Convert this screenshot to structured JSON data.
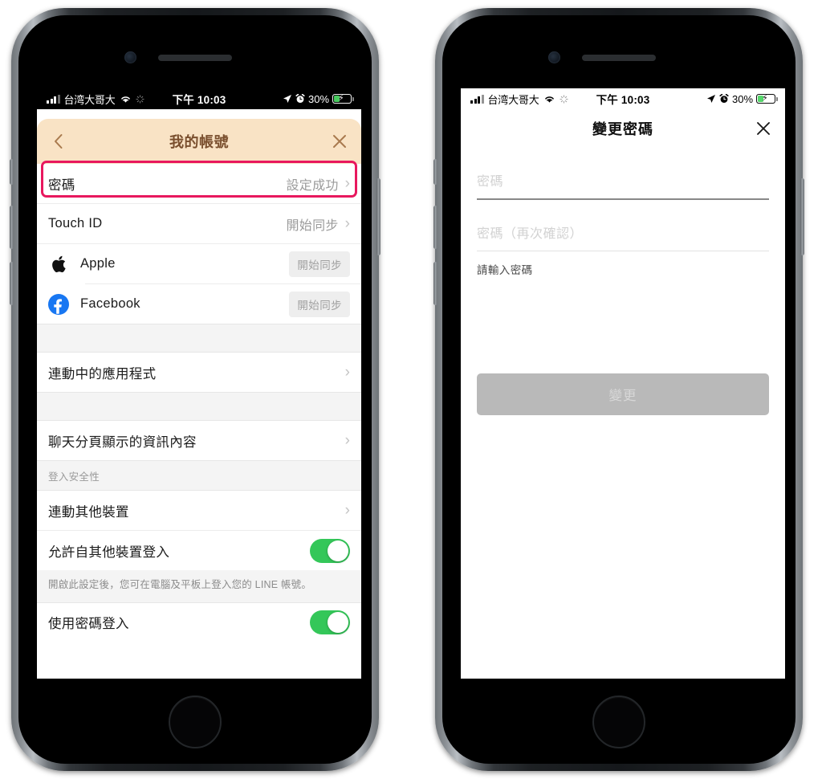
{
  "status_bar": {
    "carrier": "台湾大哥大",
    "time": "下午 10:03",
    "battery_percent": "30%",
    "icons": {
      "signal": "signal-bars-icon",
      "wifi": "wifi-icon",
      "sync": "sync-spinner-icon",
      "location": "location-arrow-icon",
      "alarm": "alarm-clock-icon",
      "battery": "battery-charging-icon"
    }
  },
  "colors": {
    "header_beige": "#f9e3c5",
    "header_beige_back": "#e7cfa9",
    "header_text": "#7a4f2e",
    "highlight_pink": "#e8185e",
    "toggle_green": "#34c759",
    "facebook_blue": "#1877f2",
    "disabled_button": "#b9b9b9"
  },
  "left_phone": {
    "header": {
      "title": "我的帳號",
      "back_icon": "chevron-left-icon",
      "close_icon": "close-x-icon"
    },
    "rows": [
      {
        "label": "密碼",
        "value": "設定成功",
        "arrow": "›",
        "highlighted": true
      },
      {
        "label": "Touch ID",
        "value": "開始同步",
        "arrow": "›",
        "highlighted": false
      }
    ],
    "brand_rows": [
      {
        "icon": "apple-logo-icon",
        "label": "Apple",
        "button": "開始同步"
      },
      {
        "icon": "facebook-logo-icon",
        "label": "Facebook",
        "button": "開始同步"
      }
    ],
    "nav_rows": [
      {
        "label": "連動中的應用程式",
        "arrow": "›"
      },
      {
        "label": "聊天分頁顯示的資訊內容",
        "arrow": "›"
      }
    ],
    "security_section": {
      "header": "登入安全性",
      "link_row": {
        "label": "連動其他裝置",
        "arrow": "›"
      },
      "toggle_rows": [
        {
          "label": "允許自其他裝置登入",
          "on": true
        },
        {
          "label": "使用密碼登入",
          "on": true
        }
      ],
      "note": "開啟此設定後，您可在電腦及平板上登入您的 LINE 帳號。"
    }
  },
  "right_phone": {
    "nav": {
      "title": "變更密碼",
      "close_icon": "close-x-icon"
    },
    "fields": [
      {
        "placeholder": "密碼",
        "value": "",
        "focused": true
      },
      {
        "placeholder": "密碼（再次確認）",
        "value": "",
        "focused": false
      }
    ],
    "hint": "請輸入密碼",
    "submit_label": "變更",
    "submit_enabled": false
  }
}
